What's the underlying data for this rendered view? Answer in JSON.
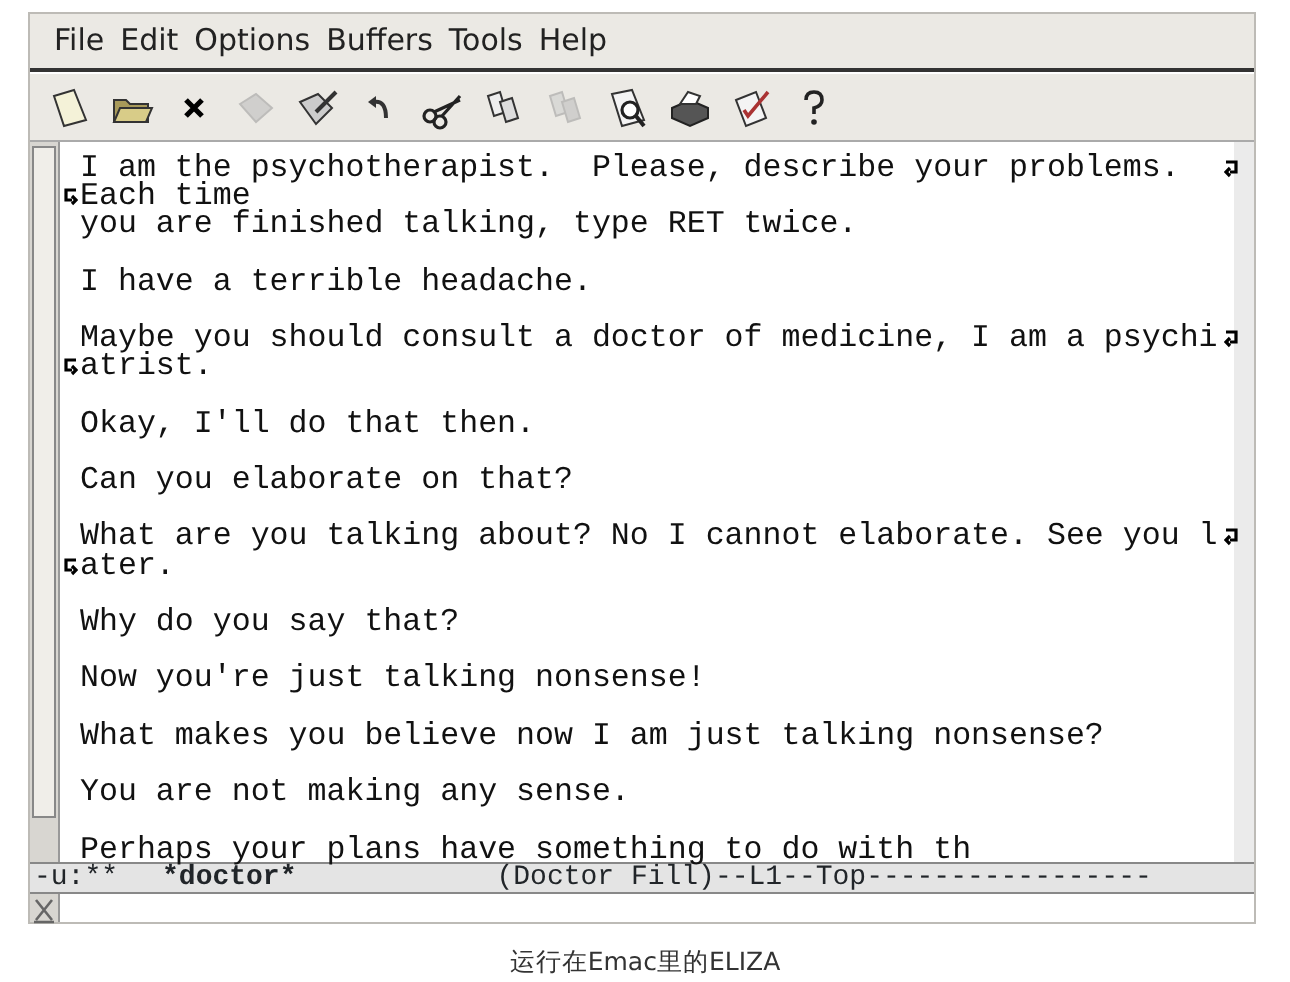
{
  "menu": [
    "File",
    "Edit",
    "Options",
    "Buffers",
    "Tools",
    "Help"
  ],
  "toolbar": [
    {
      "kind": "new",
      "disabled": false
    },
    {
      "kind": "open",
      "disabled": false
    },
    {
      "kind": "close",
      "disabled": false
    },
    {
      "kind": "save",
      "disabled": true
    },
    {
      "kind": "saveas",
      "disabled": false
    },
    {
      "kind": "undo",
      "disabled": false
    },
    {
      "kind": "cut",
      "disabled": false
    },
    {
      "kind": "copy",
      "disabled": false
    },
    {
      "kind": "paste",
      "disabled": true
    },
    {
      "kind": "search",
      "disabled": false
    },
    {
      "kind": "print",
      "disabled": false
    },
    {
      "kind": "spell",
      "disabled": false
    },
    {
      "kind": "help",
      "disabled": false
    }
  ],
  "buffer": {
    "paragraphs": [
      {
        "lines": [
          {
            "text": "I am the psychotherapist.  Please, describe your problems.",
            "continued": true
          },
          {
            "text": "Each time",
            "continued": false
          },
          {
            "text": "you are finished talking, type RET twice.",
            "continued": false
          }
        ]
      },
      {
        "lines": [
          {
            "text": "I have a terrible headache.",
            "continued": false
          }
        ]
      },
      {
        "lines": [
          {
            "text": "Maybe you should consult a doctor of medicine, I am a psychi",
            "continued": true
          },
          {
            "text": "atrist.",
            "continued": false
          }
        ]
      },
      {
        "lines": [
          {
            "text": "Okay, I'll do that then.",
            "continued": false
          }
        ]
      },
      {
        "lines": [
          {
            "text": "Can you elaborate on that?",
            "continued": false
          }
        ]
      },
      {
        "lines": [
          {
            "text": "What are you talking about? No I cannot elaborate. See you l",
            "continued": true
          },
          {
            "text": "ater.",
            "continued": false
          }
        ]
      },
      {
        "lines": [
          {
            "text": "Why do you say that?",
            "continued": false
          }
        ]
      },
      {
        "lines": [
          {
            "text": "Now you're just talking nonsense!",
            "continued": false
          }
        ]
      },
      {
        "lines": [
          {
            "text": "What makes you believe now I am just talking nonsense?",
            "continued": false
          }
        ]
      },
      {
        "lines": [
          {
            "text": "You are not making any sense.",
            "continued": false
          }
        ]
      },
      {
        "lines": [
          {
            "text": "Perhaps your plans have something to do with th",
            "continued": false
          }
        ]
      }
    ]
  },
  "mode_line": [
    {
      "text": "-u:**",
      "bold": false
    },
    {
      "text": "*doctor*",
      "bold": true
    },
    {
      "text": "(Doctor Fill)--L1--Top-----------------",
      "bold": false
    }
  ],
  "caption": "运行在Emac里的ELIZA"
}
